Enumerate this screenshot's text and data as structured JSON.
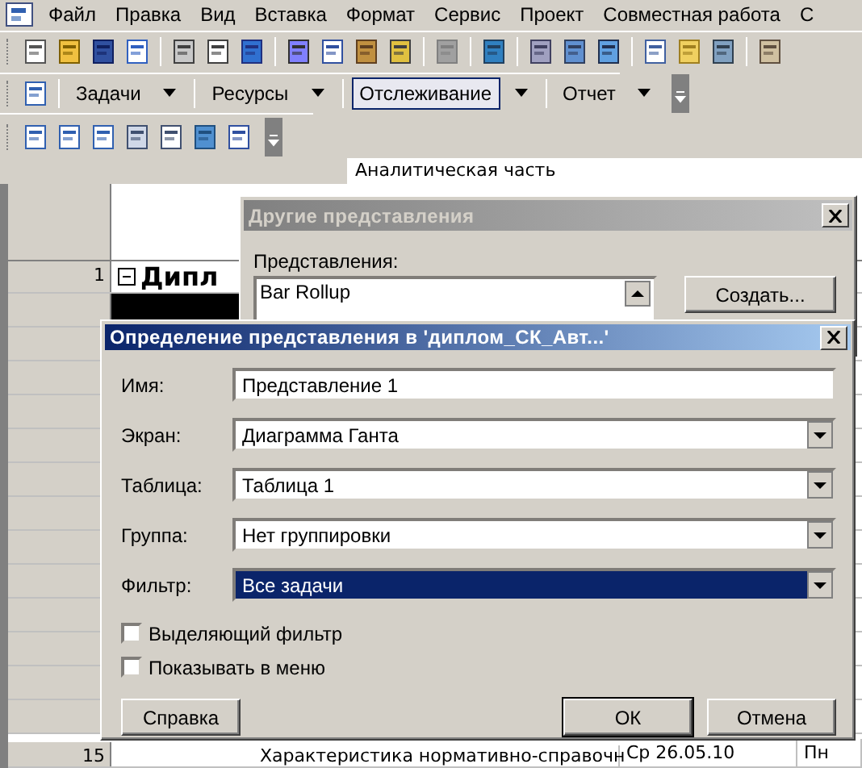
{
  "menu_bar": {
    "items": [
      "Файл",
      "Правка",
      "Вид",
      "Вставка",
      "Формат",
      "Сервис",
      "Проект",
      "Совместная работа",
      "С"
    ]
  },
  "views_toolbar": {
    "items": [
      {
        "label": "Задачи",
        "selected": false
      },
      {
        "label": "Ресурсы",
        "selected": false
      },
      {
        "label": "Отслеживание",
        "selected": true
      },
      {
        "label": "Отчет",
        "selected": false
      }
    ]
  },
  "entry_bar": {
    "value": "Аналитическая часть"
  },
  "task_table": {
    "rows": [
      {
        "number": "1",
        "name": "Дипл",
        "kind": "summary",
        "selected": false
      },
      {
        "kind": "blank",
        "selected": true
      },
      {
        "number": "15",
        "name": "Характеристика нормативно-справочн",
        "start": "Ср 26.05.10",
        "finish": "Пн",
        "kind": "task",
        "selected": false
      }
    ]
  },
  "other_views_dialog": {
    "title": "Другие представления",
    "list_label": "Представления:",
    "views": [
      "Bar Rollup"
    ],
    "create_button": "Создать..."
  },
  "view_definition_dialog": {
    "title": "Определение представления в 'диплом_СК_Авт...'",
    "fields": [
      {
        "label": "Имя:",
        "value": "Представление 1",
        "kind": "text",
        "focused": false
      },
      {
        "label": "Экран:",
        "value": "Диаграмма Ганта",
        "kind": "dropdown",
        "focused": false
      },
      {
        "label": "Таблица:",
        "value": "Таблица 1",
        "kind": "dropdown",
        "focused": false
      },
      {
        "label": "Группа:",
        "value": "Нет группировки",
        "kind": "dropdown",
        "focused": false
      },
      {
        "label": "Фильтр:",
        "value": "Все задачи",
        "kind": "dropdown",
        "focused": true
      }
    ],
    "checkboxes": [
      {
        "label": "Выделяющий фильтр",
        "checked": false
      },
      {
        "label": "Показывать в меню",
        "checked": false
      }
    ],
    "buttons": [
      {
        "label": "Справка",
        "kind": "help",
        "default": false
      },
      {
        "label": "ОК",
        "kind": "ok",
        "default": true
      },
      {
        "label": "Отмена",
        "kind": "cancel",
        "default": false
      }
    ]
  }
}
